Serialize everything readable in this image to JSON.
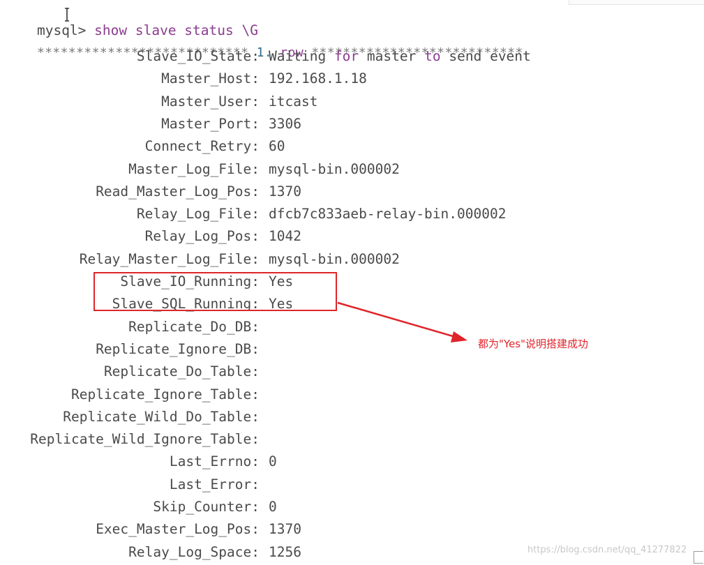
{
  "terminal": {
    "prompt": "mysql>",
    "command": "show slave status \\G",
    "row_banner_left": "***************************",
    "row_banner_num": "1.",
    "row_banner_word": "row",
    "row_banner_right": "***************************"
  },
  "fields": [
    {
      "name": "Slave_IO_State:",
      "value": "Waiting for master to send event"
    },
    {
      "name": "Master_Host:",
      "value": "192.168.1.18"
    },
    {
      "name": "Master_User:",
      "value": "itcast"
    },
    {
      "name": "Master_Port:",
      "value": "3306"
    },
    {
      "name": "Connect_Retry:",
      "value": "60"
    },
    {
      "name": "Master_Log_File:",
      "value": "mysql-bin.000002"
    },
    {
      "name": "Read_Master_Log_Pos:",
      "value": "1370"
    },
    {
      "name": "Relay_Log_File:",
      "value": "dfcb7c833aeb-relay-bin.000002"
    },
    {
      "name": "Relay_Log_Pos:",
      "value": "1042"
    },
    {
      "name": "Relay_Master_Log_File:",
      "value": "mysql-bin.000002"
    },
    {
      "name": "Slave_IO_Running:",
      "value": "Yes"
    },
    {
      "name": "Slave_SQL_Running:",
      "value": "Yes"
    },
    {
      "name": "Replicate_Do_DB:",
      "value": ""
    },
    {
      "name": "Replicate_Ignore_DB:",
      "value": ""
    },
    {
      "name": "Replicate_Do_Table:",
      "value": ""
    },
    {
      "name": "Replicate_Ignore_Table:",
      "value": ""
    },
    {
      "name": "Replicate_Wild_Do_Table:",
      "value": ""
    },
    {
      "name": "Replicate_Wild_Ignore_Table:",
      "value": ""
    },
    {
      "name": "Last_Errno:",
      "value": "0"
    },
    {
      "name": "Last_Error:",
      "value": ""
    },
    {
      "name": "Skip_Counter:",
      "value": "0"
    },
    {
      "name": "Exec_Master_Log_Pos:",
      "value": "1370"
    },
    {
      "name": "Relay_Log_Space:",
      "value": "1256"
    }
  ],
  "annotation": {
    "note": "都为\"Yes\"说明搭建成功",
    "color": "#e0242b"
  },
  "watermark": "https://blog.csdn.net/qq_41277822",
  "icons": {
    "cursor": "text-cursor-icon",
    "arrow": "red-arrow-icon"
  }
}
